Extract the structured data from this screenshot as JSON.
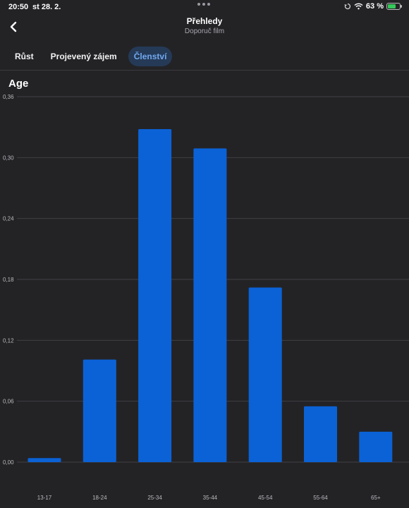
{
  "status_bar": {
    "time": "20:50",
    "date": "st 28. 2.",
    "battery": "63 %"
  },
  "nav": {
    "title": "Přehledy",
    "subtitle": "Doporuč film"
  },
  "tabs": [
    {
      "label": "Růst",
      "active": false
    },
    {
      "label": "Projevený zájem",
      "active": false
    },
    {
      "label": "Členství",
      "active": true
    }
  ],
  "section": {
    "title": "Age"
  },
  "colors": {
    "background": "#232326",
    "bar": "#0b62d6",
    "active_tab_bg": "#253a57",
    "active_tab_text": "#72a8ef"
  },
  "chart_data": {
    "type": "bar",
    "title": "Age",
    "categories": [
      "13-17",
      "18-24",
      "25-34",
      "35-44",
      "45-54",
      "55-64",
      "65+"
    ],
    "values": [
      0.004,
      0.101,
      0.328,
      0.309,
      0.172,
      0.055,
      0.03
    ],
    "yticks": [
      "0,00",
      "0,06",
      "0,12",
      "0,18",
      "0,24",
      "0,30",
      "0,36"
    ],
    "ylim": [
      0,
      0.36
    ],
    "grid": true
  }
}
